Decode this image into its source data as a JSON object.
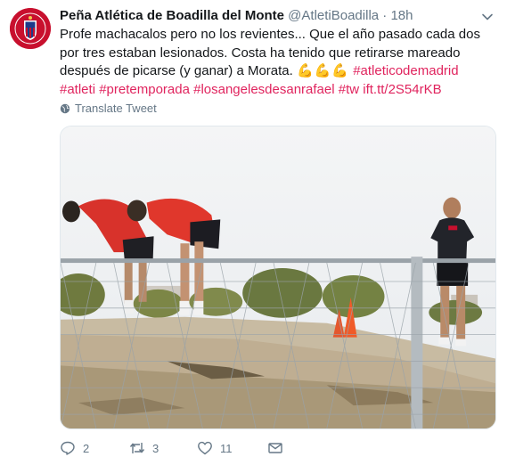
{
  "tweet": {
    "display_name": "Peña Atlética de Boadilla del Monte",
    "handle": "@AtletiBoadilla",
    "separator": "·",
    "time": "18h",
    "text_plain": "Profe machacalos pero no los revientes... Que el año pasado cada dos por tres estaban lesionados. Costa ha tenido que retirarse mareado después de picarse (y ganar) a Morata.",
    "emoji": "💪💪💪",
    "hashtag_1": "#atleticodemadrid",
    "hashtag_2": "#atleti",
    "hashtag_3": "#pretemporada",
    "hashtag_4": "#losangelesdesanrafael",
    "hashtag_5": "#tw",
    "link": "ift.tt/2S54rKB",
    "translate_label": "Translate Tweet"
  },
  "actions": {
    "reply_count": "2",
    "retweet_count": "3",
    "like_count": "11"
  },
  "colors": {
    "accent": "#e0245e",
    "secondary_text": "#657786",
    "brand_red": "#c8102e"
  },
  "icons": [
    "chevron-down-icon",
    "globe-icon",
    "reply-icon",
    "retweet-icon",
    "like-icon",
    "share-icon"
  ]
}
